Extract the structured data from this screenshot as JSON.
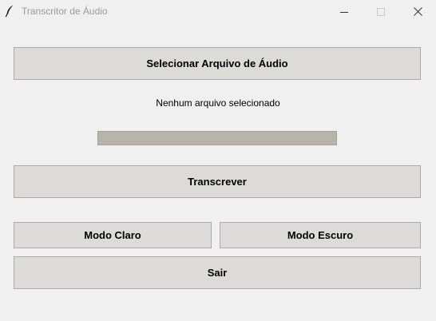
{
  "window": {
    "title": "Transcritor de Áudio",
    "controls": [
      "minimize-icon",
      "maximize-icon",
      "close-icon"
    ]
  },
  "main": {
    "select_button_label": "Selecionar Arquivo de Áudio",
    "status_text": "Nenhum arquivo selecionado",
    "progress": 0,
    "transcribe_button_label": "Transcrever",
    "light_mode_button_label": "Modo Claro",
    "dark_mode_button_label": "Modo Escuro",
    "exit_button_label": "Sair"
  },
  "colors": {
    "background": "#f0f0f0",
    "button_background": "#dddbd7",
    "button_border": "#a9a9a9",
    "progress_trough": "#bab3aa"
  }
}
